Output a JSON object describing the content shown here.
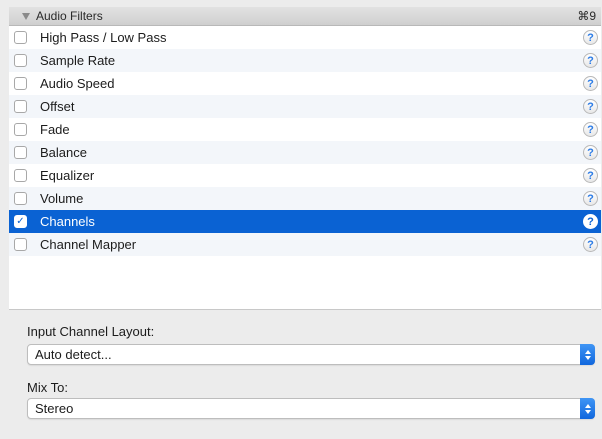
{
  "header": {
    "title": "Audio Filters",
    "shortcut": "⌘9"
  },
  "filters": [
    {
      "label": "High Pass / Low Pass",
      "checked": false
    },
    {
      "label": "Sample Rate",
      "checked": false
    },
    {
      "label": "Audio Speed",
      "checked": false
    },
    {
      "label": "Offset",
      "checked": false
    },
    {
      "label": "Fade",
      "checked": false
    },
    {
      "label": "Balance",
      "checked": false
    },
    {
      "label": "Equalizer",
      "checked": false
    },
    {
      "label": "Volume",
      "checked": false
    },
    {
      "label": "Channels",
      "checked": true
    },
    {
      "label": "Channel Mapper",
      "checked": false
    }
  ],
  "help_glyph": "?",
  "check_glyph": "✓",
  "input_layout": {
    "label": "Input Channel Layout:",
    "value": "Auto detect..."
  },
  "mix_to": {
    "label": "Mix To:",
    "value": "Stereo"
  },
  "colors": {
    "selection": "#0a62d3",
    "help_icon": "#2b7be6",
    "stepper": "#1167dd"
  }
}
